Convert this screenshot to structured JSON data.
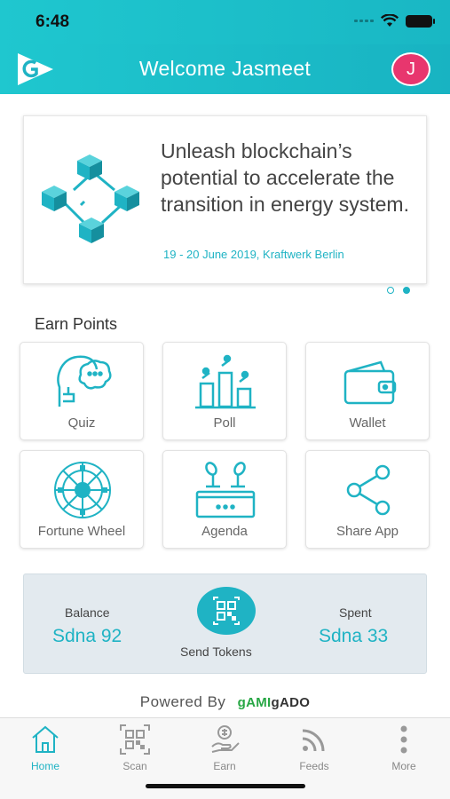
{
  "status": {
    "time": "6:48"
  },
  "header": {
    "title": "Welcome Jasmeet",
    "avatar_initial": "J"
  },
  "banner": {
    "headline": "Unleash blockchain’s potential to accelerate the transition in energy system.",
    "subtitle": "19 - 20 June 2019, Kraftwerk Berlin",
    "page_count": 2,
    "active_page": 2
  },
  "earn": {
    "title": "Earn Points",
    "tiles": [
      {
        "label": "Quiz",
        "icon": "quiz-icon"
      },
      {
        "label": "Poll",
        "icon": "poll-icon"
      },
      {
        "label": "Wallet",
        "icon": "wallet-icon"
      },
      {
        "label": "Fortune Wheel",
        "icon": "fortune-wheel-icon"
      },
      {
        "label": "Agenda",
        "icon": "agenda-icon"
      },
      {
        "label": "Share App",
        "icon": "share-icon"
      }
    ]
  },
  "tokens": {
    "balance_label": "Balance",
    "balance_value": "Sdna 92",
    "spent_label": "Spent",
    "spent_value": "Sdna 33",
    "send_label": "Send Tokens"
  },
  "footer": {
    "powered_by": "Powered By",
    "brand_a": "gAMI",
    "brand_b": "gADO"
  },
  "tabs": [
    {
      "label": "Home",
      "icon": "home-icon",
      "active": true
    },
    {
      "label": "Scan",
      "icon": "qr-scan-icon",
      "active": false
    },
    {
      "label": "Earn",
      "icon": "earn-icon",
      "active": false
    },
    {
      "label": "Feeds",
      "icon": "rss-icon",
      "active": false
    },
    {
      "label": "More",
      "icon": "more-vertical-icon",
      "active": false
    }
  ],
  "colors": {
    "accent": "#1fb3c4",
    "avatar": "#e8366e",
    "token_box": "#e3eaef"
  }
}
